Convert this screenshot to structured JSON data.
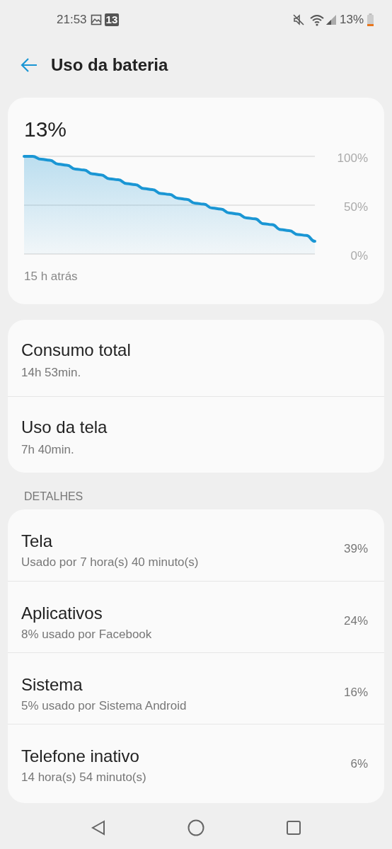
{
  "status_bar": {
    "time": "21:53",
    "notification_badge": "13",
    "battery_text": "13%"
  },
  "header": {
    "title": "Uso da bateria"
  },
  "battery_card": {
    "percent": "13%",
    "since": "15 h atrás",
    "chart_labels": [
      "100%",
      "50%",
      "0%"
    ]
  },
  "summary": [
    {
      "title": "Consumo total",
      "subtitle": "14h 53min."
    },
    {
      "title": "Uso da tela",
      "subtitle": "7h 40min."
    }
  ],
  "details_header": "DETALHES",
  "details": [
    {
      "title": "Tela",
      "subtitle": "Usado por 7 hora(s) 40 minuto(s)",
      "percent": "39%"
    },
    {
      "title": "Aplicativos",
      "subtitle": "8% usado por Facebook",
      "percent": "24%"
    },
    {
      "title": "Sistema",
      "subtitle": "5% usado por Sistema Android",
      "percent": "16%"
    },
    {
      "title": "Telefone inativo",
      "subtitle": "14 hora(s) 54 minuto(s)",
      "percent": "6%"
    }
  ]
}
